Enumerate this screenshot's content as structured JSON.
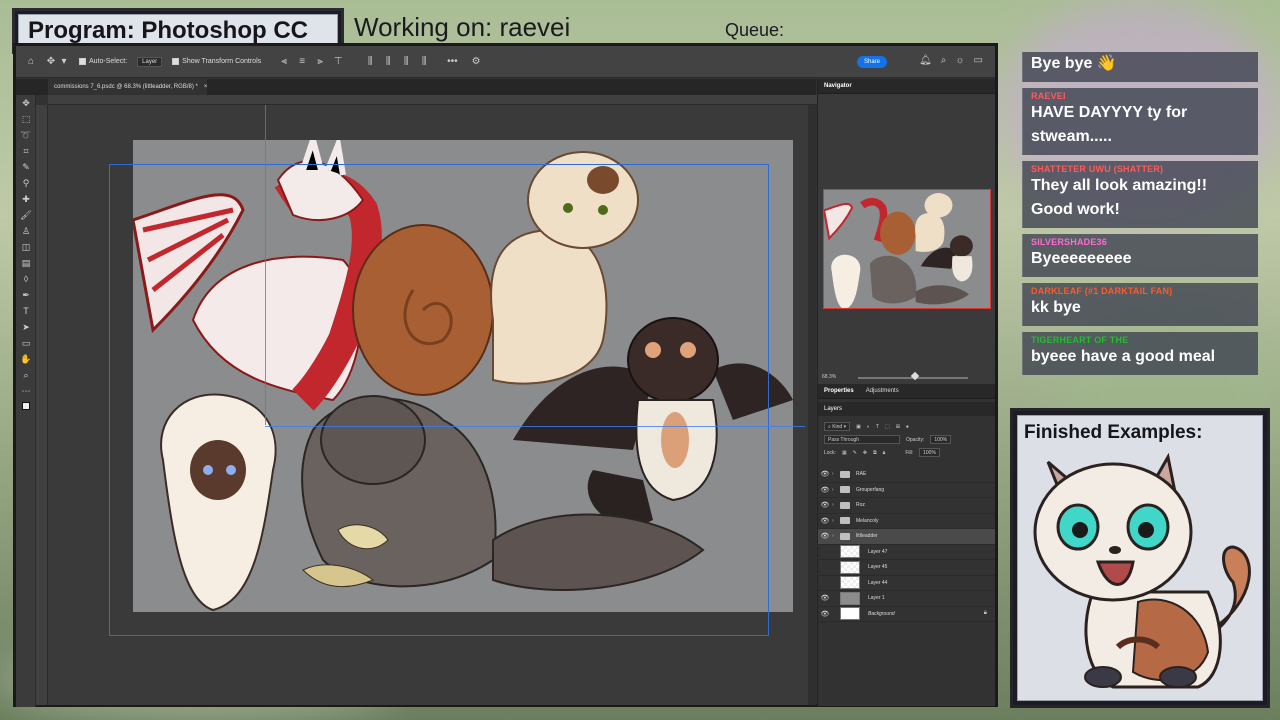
{
  "overlay": {
    "program_label": "Program: Photoshop CC",
    "working_on": "Working on: raevei",
    "queue_label": "Queue:",
    "finished_title": "Finished Examples:"
  },
  "photoshop": {
    "options_bar": {
      "auto_select": "Auto-Select:",
      "auto_select_value": "Layer",
      "show_transform": "Show Transform Controls",
      "share": "Share"
    },
    "document_tab": "commissions 7_6.psdc @ 68.3% (littleadder, RGB/8) *",
    "navigator": {
      "title": "Navigator",
      "zoom": "68.3%"
    },
    "properties_tabs": [
      "Properties",
      "Adjustments"
    ],
    "layers_title": "Layers",
    "layers_filter": "Kind",
    "blend_mode": "Pass Through",
    "opacity_label": "Opacity:",
    "opacity_value": "100%",
    "lock_label": "Lock:",
    "fill_label": "Fill:",
    "fill_value": "100%",
    "layers": [
      {
        "name": "RAE",
        "type": "folder",
        "visible": true,
        "selected": false
      },
      {
        "name": "Grouperfang",
        "type": "folder",
        "visible": true,
        "selected": false
      },
      {
        "name": "Roz",
        "type": "folder",
        "visible": true,
        "selected": false
      },
      {
        "name": "Melancoly",
        "type": "folder",
        "visible": true,
        "selected": false
      },
      {
        "name": "littleadder",
        "type": "folder",
        "visible": true,
        "selected": true
      },
      {
        "name": "Layer 47",
        "type": "layer",
        "visible": false,
        "selected": false
      },
      {
        "name": "Layer 45",
        "type": "layer",
        "visible": false,
        "selected": false
      },
      {
        "name": "Layer 44",
        "type": "layer",
        "visible": false,
        "selected": false
      },
      {
        "name": "Layer 1",
        "type": "layer",
        "visible": true,
        "selected": false
      },
      {
        "name": "Background",
        "type": "background",
        "visible": true,
        "selected": false
      }
    ]
  },
  "chat": [
    {
      "user": "",
      "text": "Bye bye 👋",
      "color": "#ffffff"
    },
    {
      "user": "RAEVEI",
      "text": "HAVE DAYYYY ty for stweam.....",
      "color": "#ff5a5a"
    },
    {
      "user": "SHATTETER UWU (SHATTER)",
      "text": "They all look amazing!! Good work!",
      "color": "#ff5a5a"
    },
    {
      "user": "SILVERSHADE36",
      "text": "Byeeeeeeeee",
      "color": "#ff6ad5"
    },
    {
      "user": "DARKLEAF (#1 DARKTAIL FAN)",
      "text": "kk bye",
      "color": "#ff5a2a"
    },
    {
      "user": "TIGERHEART OF THE",
      "text": "byeee have a good meal",
      "color": "#1fbf2f"
    }
  ]
}
